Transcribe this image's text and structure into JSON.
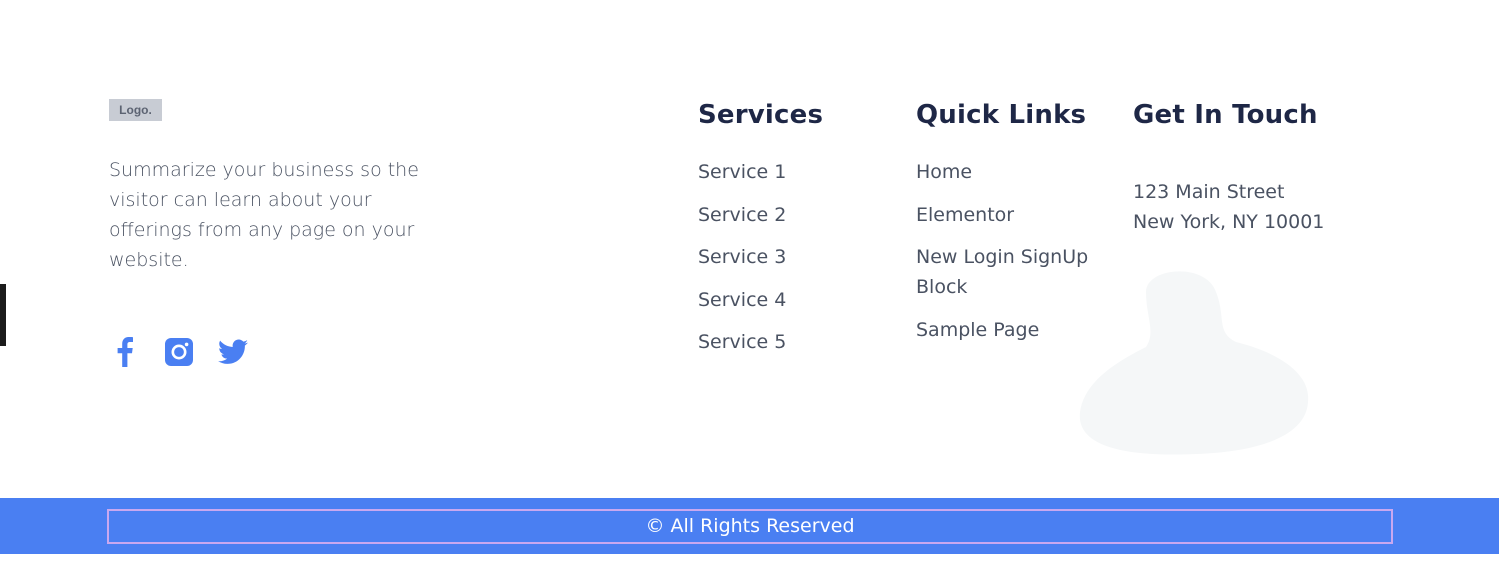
{
  "brand": {
    "logo_text": "Logo.",
    "summary": "Summarize your business so the visitor can learn about your offerings from any page on your website."
  },
  "social": [
    {
      "name": "facebook-icon"
    },
    {
      "name": "instagram-icon"
    },
    {
      "name": "twitter-icon"
    }
  ],
  "services": {
    "heading": "Services",
    "items": [
      "Service 1",
      "Service 2",
      "Service 3",
      "Service 4",
      "Service 5"
    ]
  },
  "quick_links": {
    "heading": "Quick Links",
    "items": [
      "Home",
      "Elementor",
      "New Login SignUp Block",
      "Sample Page"
    ]
  },
  "contact": {
    "heading": "Get In Touch",
    "address_line1": "123 Main Street",
    "address_line2": "New York, NY 10001"
  },
  "footer": {
    "copyright": "© All Rights Reserved"
  },
  "colors": {
    "accent": "#4a7ff2",
    "heading": "#1e2746",
    "body_text": "#4a5262",
    "icon": "#4a7ff2"
  }
}
